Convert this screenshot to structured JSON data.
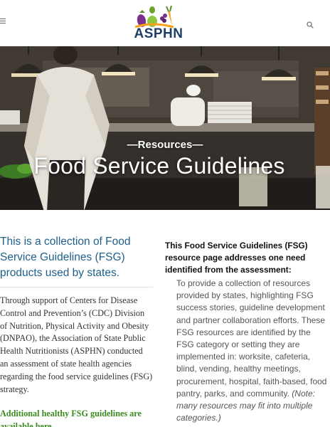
{
  "header": {
    "menu_icon": "hamburger-menu-icon",
    "search_icon": "search-icon",
    "logo_text": "ASPHN",
    "colors": {
      "logo_text": "#1f3e66",
      "logo_accent_purple": "#7b2f8f",
      "logo_accent_green": "#8dc63f",
      "logo_accent_orange": "#f7a21b"
    }
  },
  "hero": {
    "eyebrow": "—Resources—",
    "title": "Food Service Guidelines"
  },
  "intro": {
    "lead": "This is a collection of Food Service Guidelines (FSG) products used by states.",
    "body": "Through support of Centers for Disease Control and Prevention’s (CDC) Division of Nutrition, Physical Activity and Obesity (DNPAO), the Association of State Public Health Nutritionists (ASPHN) conducted an assessment of state health agencies regarding the food service guidelines (FSG) strategy.",
    "link_label": "Additional healthy FSG guidelines are available here",
    "link_suffix": ".",
    "colors": {
      "lead": "#1e5f8a",
      "link": "#3a8a1f"
    }
  },
  "aside": {
    "heading": "This Food Service Guidelines (FSG) resource page addresses one need identified from the assessment:",
    "body": "To provide a collection of resources provided by states, highlighting FSG success stories, guideline development and partner collaboration efforts. These FSG resources are identified by the FSG category or setting they are implemented in: worksite, cafeteria, blind, vending, healthy meetings, procurement, hospital, faith-based, food pantry, parks, and community.",
    "note": "(Note: many resources may fit into multiple categories.)"
  }
}
